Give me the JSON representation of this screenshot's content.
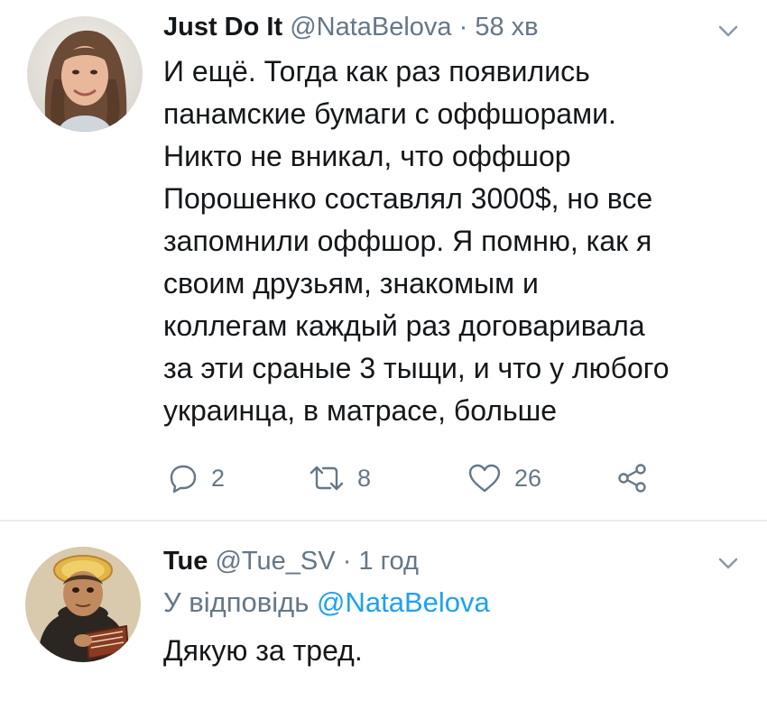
{
  "tweet1": {
    "display_name": "Just Do It",
    "handle": "@NataBelova",
    "separator": "·",
    "time": "58 хв",
    "body_lines": [
      "И ещё. Тогда как раз появились",
      "панамские бумаги с оффшорами.",
      "Никто не вникал, что оффшор",
      "Порошенко составлял 3000$, но все",
      "запомнили оффшор. Я помню, как я",
      "своим друзьям, знакомым и",
      "коллегам каждый раз договаривала",
      "за эти сраные 3 тыщи, и что у любого",
      "украинца, в матрасе, больше"
    ],
    "replies": "2",
    "retweets": "8",
    "likes": "26"
  },
  "tweet2": {
    "display_name": "Tue",
    "handle": "@Tue_SV",
    "separator": "·",
    "time": "1 год",
    "replying_prefix": "У відповідь",
    "replying_to": "@NataBelova",
    "body": "Дякую за тред."
  },
  "icons": {
    "reply": "reply-icon",
    "retweet": "retweet-icon",
    "like": "heart-icon",
    "share": "share-icon",
    "menu": "chevron-down-icon"
  },
  "colors": {
    "text": "#14171a",
    "muted": "#657786",
    "link": "#1da1f2",
    "divider": "#e6ecf0"
  }
}
